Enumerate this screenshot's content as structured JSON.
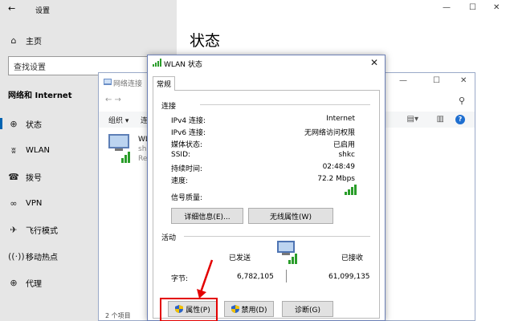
{
  "settings": {
    "window_title": "设置",
    "home": "主页",
    "search_placeholder": "查找设置",
    "section": "网络和 Internet",
    "page_title": "状态",
    "nav": [
      "状态",
      "WLAN",
      "拨号",
      "VPN",
      "飞行模式",
      "移动热点",
      "代理"
    ]
  },
  "netconn": {
    "title": "网络连接",
    "organize": "组织 ▾",
    "organize_next": "连",
    "item_name": "WL",
    "item_sub1": "shk",
    "item_sub2": "Re",
    "status_bar": "2 个项目"
  },
  "dialog": {
    "title": "WLAN 状态",
    "tab": "常规",
    "connection_group": "连接",
    "rows": [
      {
        "label": "IPv4 连接:",
        "value": "Internet"
      },
      {
        "label": "IPv6 连接:",
        "value": "无网络访问权限"
      },
      {
        "label": "媒体状态:",
        "value": "已启用"
      },
      {
        "label": "SSID:",
        "value": "shkc"
      },
      {
        "label": "持续时间:",
        "value": "02:48:49"
      },
      {
        "label": "速度:",
        "value": "72.2 Mbps"
      }
    ],
    "signal_label": "信号质量:",
    "details_button": "详细信息(E)...",
    "wireless_props_button": "无线属性(W)",
    "activity_group": "活动",
    "sent_label": "已发送",
    "received_label": "已接收",
    "bytes_label": "字节:",
    "bytes_sent": "6,782,105",
    "bytes_received": "61,099,135",
    "properties_button": "属性(P)",
    "disable_button": "禁用(D)",
    "diagnose_button": "诊断(G)"
  },
  "colors": {
    "highlight_box": "#e30000",
    "accent": "#0063b1"
  }
}
